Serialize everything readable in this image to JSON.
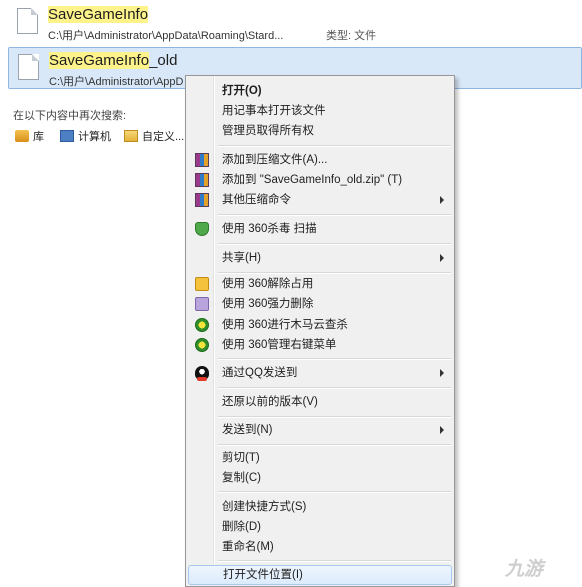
{
  "files": [
    {
      "name": "SaveGameInfo",
      "path": "C:\\用户\\Administrator\\AppData\\Roaming\\Stard...",
      "type_label": "类型:",
      "type": "文件"
    },
    {
      "name_highlight": "SaveGameInfo",
      "name_rest": "_old",
      "path": "C:\\用户\\Administrator\\AppD"
    }
  ],
  "search_again": {
    "label": "在以下内容中再次搜索:",
    "locations": [
      "库",
      "计算机",
      "自定义..."
    ]
  },
  "context_menu": {
    "items": [
      {
        "label": "打开(O)",
        "bold": true
      },
      {
        "label": "用记事本打开该文件"
      },
      {
        "label": "管理员取得所有权"
      },
      {
        "label": "添加到压缩文件(A)...",
        "icon": "archive-icon"
      },
      {
        "label": "添加到 \"SaveGameInfo_old.zip\" (T)",
        "icon": "archive-icon"
      },
      {
        "label": "其他压缩命令",
        "icon": "archive-icon",
        "submenu": true
      },
      {
        "label": "使用 360杀毒 扫描",
        "icon": "shield-icon"
      },
      {
        "label": "共享(H)",
        "submenu": true
      },
      {
        "label": "使用 360解除占用",
        "icon": "unlock-icon"
      },
      {
        "label": "使用 360强力删除",
        "icon": "shred-icon"
      },
      {
        "label": "使用 360进行木马云查杀",
        "icon": "360-icon"
      },
      {
        "label": "使用 360管理右键菜单",
        "icon": "360-icon"
      },
      {
        "label": "通过QQ发送到",
        "icon": "qq-icon",
        "submenu": true
      },
      {
        "label": "还原以前的版本(V)"
      },
      {
        "label": "发送到(N)",
        "submenu": true
      },
      {
        "label": "剪切(T)"
      },
      {
        "label": "复制(C)"
      },
      {
        "label": "创建快捷方式(S)"
      },
      {
        "label": "删除(D)"
      },
      {
        "label": "重命名(M)"
      },
      {
        "label": "打开文件位置(I)",
        "selected": true
      }
    ]
  },
  "watermark": "九游",
  "colors": {
    "highlight": "#fdf38a",
    "selection": "#d9e8f9",
    "menu_bg": "#f0f0f0"
  }
}
